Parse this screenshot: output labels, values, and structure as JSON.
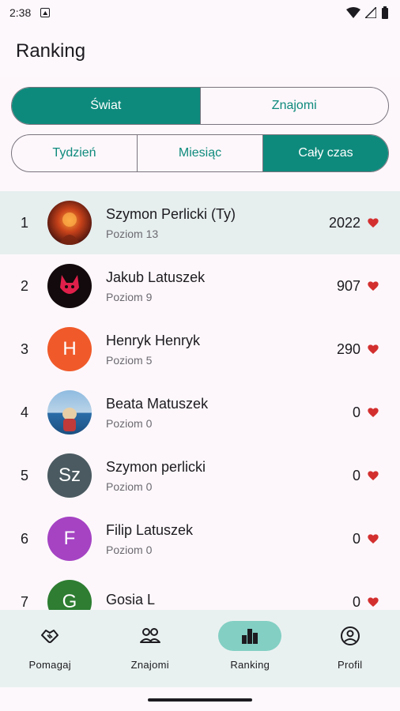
{
  "status": {
    "time": "2:38"
  },
  "app_title": "Ranking",
  "scope_tabs": [
    {
      "label": "Świat",
      "active": true
    },
    {
      "label": "Znajomi",
      "active": false
    }
  ],
  "period_tabs": [
    {
      "label": "Tydzień",
      "active": false
    },
    {
      "label": "Miesiąc",
      "active": false
    },
    {
      "label": "Cały czas",
      "active": true
    }
  ],
  "ranking": [
    {
      "rank": "1",
      "name": "Szymon Perlicki (Ty)",
      "level": "Poziom 13",
      "score": "2022",
      "avatar": "photo-fire",
      "is_me": true
    },
    {
      "rank": "2",
      "name": "Jakub Latuszek",
      "level": "Poziom 9",
      "score": "907",
      "avatar": "photo-red-cat",
      "is_me": false
    },
    {
      "rank": "3",
      "name": "Henryk Henryk",
      "level": "Poziom 5",
      "score": "290",
      "avatar_letter": "H",
      "avatar_color": "#f05a2a",
      "is_me": false
    },
    {
      "rank": "4",
      "name": "Beata Matuszek",
      "level": "Poziom 0",
      "score": "0",
      "avatar": "photo-beach",
      "is_me": false
    },
    {
      "rank": "5",
      "name": "Szymon perlicki",
      "level": "Poziom 0",
      "score": "0",
      "avatar_letter": "Sz",
      "avatar_color": "#4a5a60",
      "is_me": false
    },
    {
      "rank": "6",
      "name": "Filip Latuszek",
      "level": "Poziom 0",
      "score": "0",
      "avatar_letter": "F",
      "avatar_color": "#a543c3",
      "is_me": false
    },
    {
      "rank": "7",
      "name": "Gosia L",
      "level": "",
      "score": "0",
      "avatar_letter": "G",
      "avatar_color": "#2e7d32",
      "is_me": false
    }
  ],
  "bottom_nav": [
    {
      "label": "Pomagaj",
      "icon": "handshake-icon",
      "active": false
    },
    {
      "label": "Znajomi",
      "icon": "people-icon",
      "active": false
    },
    {
      "label": "Ranking",
      "icon": "leaderboard-icon",
      "active": true
    },
    {
      "label": "Profil",
      "icon": "account-circle-icon",
      "active": false
    }
  ],
  "colors": {
    "primary": "#0e8a7c",
    "heart": "#d32f2f",
    "nav_active": "#83cfc4"
  }
}
